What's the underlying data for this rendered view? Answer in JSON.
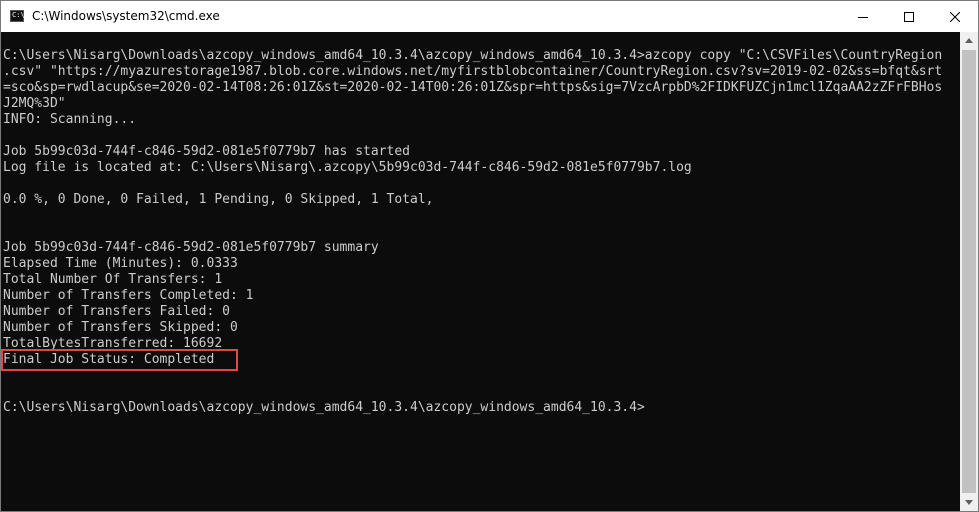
{
  "window": {
    "title": "C:\\Windows\\system32\\cmd.exe",
    "icon_text": "C:\\",
    "controls": [
      "minimize-icon",
      "maximize-icon",
      "close-icon"
    ]
  },
  "console": {
    "lines": [
      "C:\\Users\\Nisarg\\Downloads\\azcopy_windows_amd64_10.3.4\\azcopy_windows_amd64_10.3.4>azcopy copy \"C:\\CSVFiles\\CountryRegion",
      ".csv\" \"https://myazurestorage1987.blob.core.windows.net/myfirstblobcontainer/CountryRegion.csv?sv=2019-02-02&ss=bfqt&srt",
      "=sco&sp=rwdlacup&se=2020-02-14T08:26:01Z&st=2020-02-14T00:26:01Z&spr=https&sig=7VzcArpbD%2FIDKFUZCjn1mcl1ZqaAA2zZFrFBHos",
      "J2MQ%3D\"",
      "INFO: Scanning...",
      "",
      "Job 5b99c03d-744f-c846-59d2-081e5f0779b7 has started",
      "Log file is located at: C:\\Users\\Nisarg\\.azcopy\\5b99c03d-744f-c846-59d2-081e5f0779b7.log",
      "",
      "0.0 %, 0 Done, 0 Failed, 1 Pending, 0 Skipped, 1 Total,",
      "",
      "",
      "Job 5b99c03d-744f-c846-59d2-081e5f0779b7 summary",
      "Elapsed Time (Minutes): 0.0333",
      "Total Number Of Transfers: 1",
      "Number of Transfers Completed: 1",
      "Number of Transfers Failed: 0",
      "Number of Transfers Skipped: 0",
      "TotalBytesTransferred: 16692",
      "Final Job Status: Completed",
      "",
      "",
      "C:\\Users\\Nisarg\\Downloads\\azcopy_windows_amd64_10.3.4\\azcopy_windows_amd64_10.3.4>"
    ],
    "highlight_color": "#e04848"
  },
  "colors": {
    "console_bg": "#0c0c0c",
    "console_text": "#cccccc",
    "titlebar_bg": "#ffffff",
    "scrollbar_bg": "#f0f0f0"
  }
}
